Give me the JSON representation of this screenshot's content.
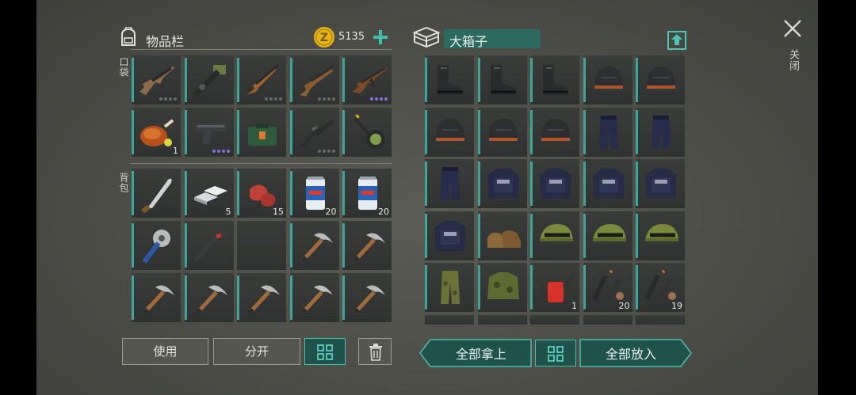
{
  "inventory": {
    "title": "物品栏",
    "coins": "5135",
    "pocket_label": "口袋",
    "backpack_label": "背包",
    "pocket_slots": [
      {
        "icon": "assault-rifle-icon",
        "count": "",
        "dots": "gray"
      },
      {
        "icon": "rocket-launcher-icon",
        "count": "",
        "dots": ""
      },
      {
        "icon": "hunting-rifle-icon",
        "count": "",
        "dots": "gray"
      },
      {
        "icon": "shotgun-icon",
        "count": "",
        "dots": "gray"
      },
      {
        "icon": "ak-rifle-icon",
        "count": "",
        "dots": "purple"
      },
      {
        "icon": "roast-chicken-icon",
        "count": "1",
        "dots": ""
      },
      {
        "icon": "pistol-icon",
        "count": "",
        "dots": "purple"
      },
      {
        "icon": "medkit-bag-icon",
        "count": "",
        "dots": ""
      },
      {
        "icon": "m16-rifle-icon",
        "count": "",
        "dots": "gray"
      },
      {
        "icon": "magnifier-tool-icon",
        "count": "",
        "dots": ""
      }
    ],
    "backpack_slots": [
      {
        "icon": "machete-icon",
        "count": ""
      },
      {
        "icon": "metal-ingot-icon",
        "count": "5"
      },
      {
        "icon": "raw-meat-icon",
        "count": "15"
      },
      {
        "icon": "beer-can-icon",
        "count": "20"
      },
      {
        "icon": "beer-can-icon",
        "count": "20"
      },
      {
        "icon": "saw-blade-club-icon",
        "count": ""
      },
      {
        "icon": "crowbar-icon",
        "count": ""
      },
      {
        "icon": "empty-slot",
        "count": ""
      },
      {
        "icon": "pickaxe-icon",
        "count": ""
      },
      {
        "icon": "pickaxe-icon",
        "count": ""
      },
      {
        "icon": "pickaxe-icon",
        "count": ""
      },
      {
        "icon": "pickaxe-icon",
        "count": ""
      },
      {
        "icon": "pickaxe-icon",
        "count": ""
      },
      {
        "icon": "pickaxe-icon",
        "count": ""
      },
      {
        "icon": "pickaxe-icon",
        "count": ""
      }
    ],
    "use_button": "使用",
    "split_button": "分开"
  },
  "box": {
    "title": "大箱子",
    "slots": [
      {
        "icon": "boots-icon",
        "count": ""
      },
      {
        "icon": "boots-icon",
        "count": ""
      },
      {
        "icon": "boots-icon",
        "count": ""
      },
      {
        "icon": "helmet-icon",
        "count": ""
      },
      {
        "icon": "helmet-icon",
        "count": ""
      },
      {
        "icon": "helmet-icon",
        "count": ""
      },
      {
        "icon": "helmet-icon",
        "count": ""
      },
      {
        "icon": "helmet-icon",
        "count": ""
      },
      {
        "icon": "pants-icon",
        "count": ""
      },
      {
        "icon": "pants-icon",
        "count": ""
      },
      {
        "icon": "pants-icon",
        "count": ""
      },
      {
        "icon": "tactical-vest-icon",
        "count": ""
      },
      {
        "icon": "tactical-vest-icon",
        "count": ""
      },
      {
        "icon": "tactical-vest-icon",
        "count": ""
      },
      {
        "icon": "tactical-vest-icon",
        "count": ""
      },
      {
        "icon": "tactical-vest-icon",
        "count": ""
      },
      {
        "icon": "leather-shoes-icon",
        "count": ""
      },
      {
        "icon": "camo-cap-icon",
        "count": ""
      },
      {
        "icon": "camo-cap-icon",
        "count": ""
      },
      {
        "icon": "camo-cap-icon",
        "count": ""
      },
      {
        "icon": "camo-pants-icon",
        "count": ""
      },
      {
        "icon": "camo-jacket-icon",
        "count": ""
      },
      {
        "icon": "oil-can-icon",
        "count": "1"
      },
      {
        "icon": "gun-parts-icon",
        "count": "20"
      },
      {
        "icon": "gun-parts-icon",
        "count": "19"
      }
    ],
    "take_all": "全部拿上",
    "put_all": "全部放入"
  },
  "close_label": "关闭",
  "colors": {
    "accent": "#3aa79a",
    "coin": "#e5b514"
  }
}
